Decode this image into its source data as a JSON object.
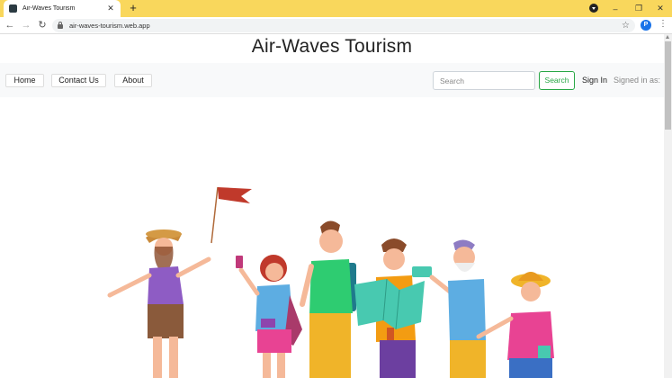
{
  "browser": {
    "tab_title": "Air-Waves Tourism",
    "tab_close": "✕",
    "new_tab": "+",
    "url": "air-waves-tourism.web.app",
    "profile_initial": "P",
    "controls": {
      "minimize": "–",
      "restore": "❐",
      "close": "✕"
    }
  },
  "site": {
    "title": "Air-Waves Tourism"
  },
  "nav": {
    "links": [
      "Home",
      "Contact Us",
      "About"
    ],
    "search_placeholder": "Search",
    "search_button": "Search",
    "sign_in": "Sign In",
    "signed_in_as": "Signed in as:"
  },
  "colors": {
    "chrome_accent": "#f9d75c",
    "success_green": "#28a745",
    "navbar_bg": "#f8f9fa"
  }
}
